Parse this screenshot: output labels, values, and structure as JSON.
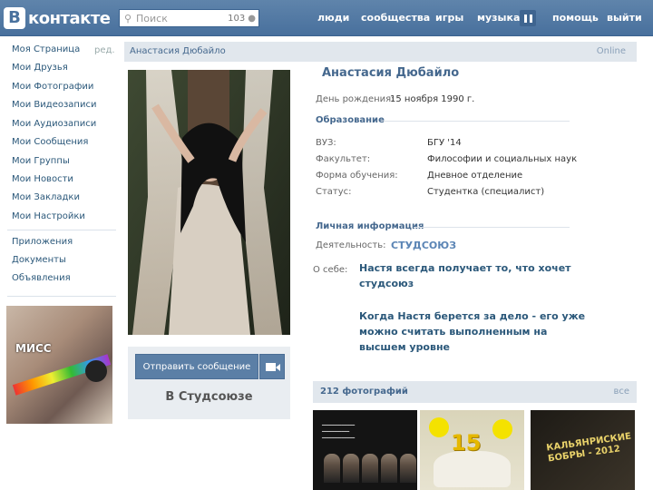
{
  "header": {
    "logo_letter": "В",
    "logo_text": "контакте",
    "search_placeholder": "Поиск",
    "search_count": "103",
    "nav": [
      "люди",
      "сообщества",
      "игры",
      "музыка",
      "помощь",
      "выйти"
    ]
  },
  "sidebar": {
    "edit_label": "ред.",
    "items": [
      "Моя Страница",
      "Мои Друзья",
      "Мои Фотографии",
      "Мои Видеозаписи",
      "Мои Аудиозаписи",
      "Мои Сообщения",
      "Мои Группы",
      "Мои Новости",
      "Мои Закладки",
      "Мои Настройки"
    ],
    "items2": [
      "Приложения",
      "Документы",
      "Объявления"
    ],
    "banner_text": "МИСС"
  },
  "profile_bar": {
    "name": "Анастасия Дюбайло",
    "link": "Online"
  },
  "profile": {
    "name": "Анастасия Дюбайло",
    "birthday_label": "День рождения:",
    "birthday_value": "15 ноября 1990 г.",
    "education_title": "Образование",
    "edu": [
      {
        "label": "ВУЗ:",
        "value": "БГУ '14"
      },
      {
        "label": "Факультет:",
        "value": "Философии и социальных наук"
      },
      {
        "label": "Форма обучения:",
        "value": "Дневное отделение"
      },
      {
        "label": "Статус:",
        "value": "Студентка (специалист)"
      }
    ],
    "personal_title": "Личная информация",
    "activity_label": "Деятельность:",
    "activity_value": "СТУДСОЮЗ",
    "about_label": "О себе:",
    "about_lines": [
      "Настя всегда получает то, что хочет",
      "студсоюз",
      "",
      "Когда Настя берется за дело - его уже",
      "можно считать выполненным на",
      "высшем уровне"
    ]
  },
  "actions": {
    "send_message": "Отправить сообщение",
    "group": "В Студсоюзе"
  },
  "photos": {
    "count_label": "212 фотографий",
    "all_label": "все",
    "t2_number": "15",
    "t3_lines": [
      "КАЛЬЯНРИСКИЕ",
      "БОБРЫ - 2012"
    ]
  },
  "colors": {
    "header": "#4f77a2",
    "link": "#2b587a",
    "section": "#45688e"
  }
}
